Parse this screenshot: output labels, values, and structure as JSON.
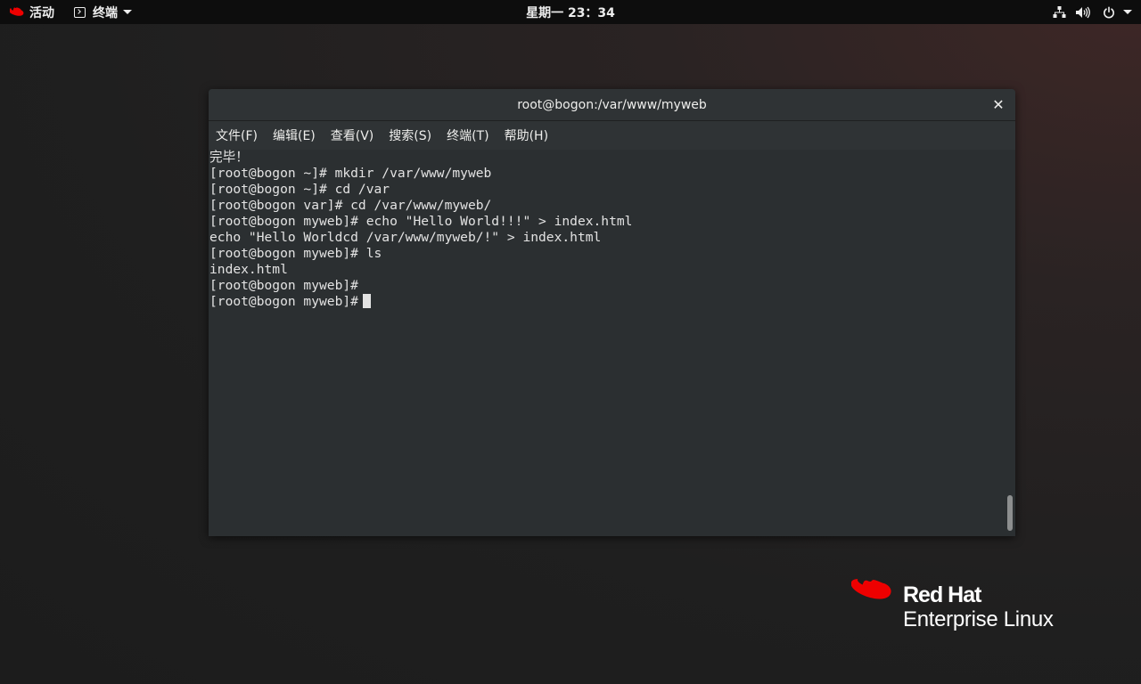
{
  "topbar": {
    "activities_label": "活动",
    "app_menu_label": "终端",
    "clock": "星期一 23：34",
    "icons": [
      "network-icon",
      "volume-icon",
      "power-icon",
      "chevron-down-icon"
    ]
  },
  "window": {
    "title": "root@bogon:/var/www/myweb",
    "menu": [
      "文件(F)",
      "编辑(E)",
      "查看(V)",
      "搜索(S)",
      "终端(T)",
      "帮助(H)"
    ]
  },
  "terminal": {
    "lines": [
      "完毕！",
      "[root@bogon ~]# mkdir /var/www/myweb",
      "[root@bogon ~]# cd /var",
      "[root@bogon var]# cd /var/www/myweb/",
      "[root@bogon myweb]# echo \"Hello World!!!\" > index.html",
      "echo \"Hello Worldcd /var/www/myweb/!\" > index.html",
      "[root@bogon myweb]# ls",
      "index.html",
      "[root@bogon myweb]#",
      "[root@bogon myweb]#"
    ]
  },
  "branding": {
    "line1": "Red Hat",
    "line2": "Enterprise Linux",
    "accent_color": "#ee0000"
  }
}
